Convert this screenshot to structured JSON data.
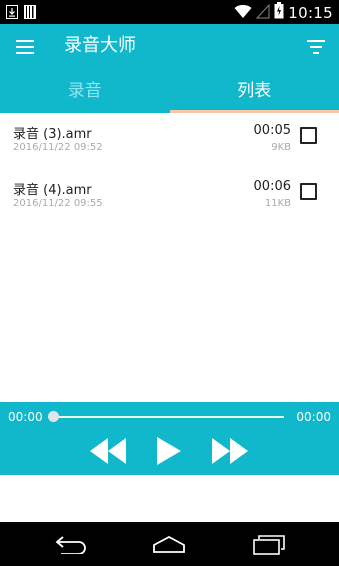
{
  "status_bar": {
    "time": "10:15"
  },
  "app_bar": {
    "title": "录音大师"
  },
  "tabs": [
    {
      "label": "录音",
      "selected": false
    },
    {
      "label": "列表",
      "selected": true
    }
  ],
  "recordings": [
    {
      "name": "录音 (3).amr",
      "date": "2016/11/22 09:52",
      "duration": "00:05",
      "size": "9KB",
      "checked": false
    },
    {
      "name": "录音 (4).amr",
      "date": "2016/11/22 09:55",
      "duration": "00:06",
      "size": "11KB",
      "checked": false
    }
  ],
  "player": {
    "current_time": "00:00",
    "total_time": "00:00",
    "progress": 0
  },
  "colors": {
    "primary": "#11b8cc",
    "tab_indicator": "#f5c7a8"
  }
}
